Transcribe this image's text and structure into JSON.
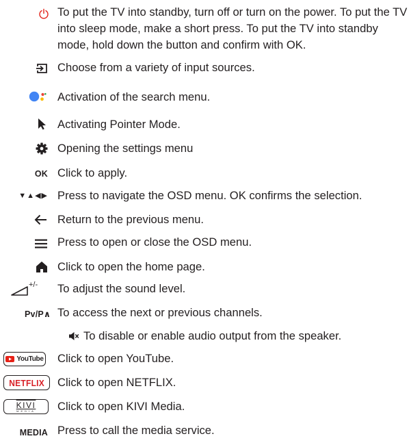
{
  "items": [
    {
      "icon": "power-icon",
      "text": "To put the TV into standby, turn off or turn on the power. To put the TV into sleep mode, make a short press. To put the TV into standby mode, hold down the button and confirm with OK."
    },
    {
      "icon": "input-source-icon",
      "text": "Choose from a variety of input sources."
    },
    {
      "icon": "google-assistant-icon",
      "text": "Activation of the search menu."
    },
    {
      "icon": "pointer-icon",
      "text": "Activating Pointer Mode."
    },
    {
      "icon": "gear-icon",
      "label": "",
      "text": "Opening the settings menu"
    },
    {
      "icon": "ok-label",
      "label": "OK",
      "text": "Click to apply."
    },
    {
      "icon": "navigation-arrows-icon",
      "label": "▼▲◀▶",
      "text": "Press to navigate the OSD menu. OK confirms the selection."
    },
    {
      "icon": "back-arrow-icon",
      "text": "Return to the previous menu."
    },
    {
      "icon": "menu-icon",
      "text": "Press to open or close the OSD menu."
    },
    {
      "icon": "home-icon",
      "text": "Click to open the home page."
    },
    {
      "icon": "volume-icon",
      "label": "+/-",
      "text": "To adjust the sound level."
    },
    {
      "icon": "channel-label",
      "label": "Pv/P∧",
      "text": "To access the next or previous channels."
    },
    {
      "icon": "mute-icon",
      "text": "To disable or enable audio output from the speaker."
    },
    {
      "icon": "youtube-logo",
      "label": "YouTube",
      "text": "Click to open YouTube."
    },
    {
      "icon": "netflix-logo",
      "label": "NETFLIX",
      "text": "Click to open NETFLIX."
    },
    {
      "icon": "kivi-logo",
      "label": "KIVI",
      "sublabel": "MEDIA",
      "text": "Click to open KIVI Media."
    },
    {
      "icon": "media-label",
      "label": "MEDIA",
      "text": "Press to call the media service."
    }
  ],
  "colors": {
    "text": "#231f20",
    "power": "#e2231a",
    "youtube_red": "#e62117",
    "netflix_red": "#d81f26",
    "google_blue": "#4285f4",
    "google_red": "#ea4335",
    "google_yellow": "#fbbc05",
    "google_green": "#34a853"
  }
}
